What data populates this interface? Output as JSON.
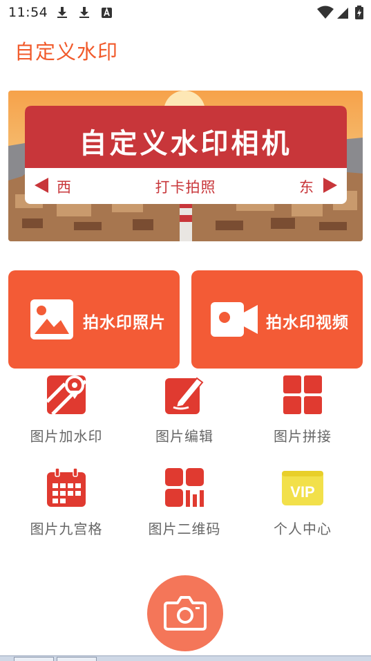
{
  "status_bar": {
    "time": "11:54",
    "left_icons": [
      "download-icon",
      "download-icon",
      "font-a-icon"
    ],
    "right_icons": [
      "wifi-icon",
      "cell-signal-icon",
      "battery-charging-icon"
    ]
  },
  "app": {
    "title": "自定义水印",
    "accent_color": "#f15a2b"
  },
  "banner": {
    "title": "自定义水印相机",
    "left_direction": "西",
    "right_direction": "东",
    "subtitle": "打卡拍照",
    "sign_color": "#c8363a"
  },
  "primary_actions": [
    {
      "label": "拍水印照片",
      "icon": "image-icon"
    },
    {
      "label": "拍水印视频",
      "icon": "video-camera-icon"
    }
  ],
  "features": [
    {
      "label": "图片加水印",
      "icon": "map-pin-icon"
    },
    {
      "label": "图片编辑",
      "icon": "edit-icon"
    },
    {
      "label": "图片拼接",
      "icon": "grid-icon"
    },
    {
      "label": "图片九宫格",
      "icon": "calendar-icon"
    },
    {
      "label": "图片二维码",
      "icon": "qr-code-icon"
    },
    {
      "label": "个人中心",
      "icon": "vip-icon",
      "badge": "VIP"
    }
  ],
  "fab": {
    "icon": "camera-icon"
  }
}
